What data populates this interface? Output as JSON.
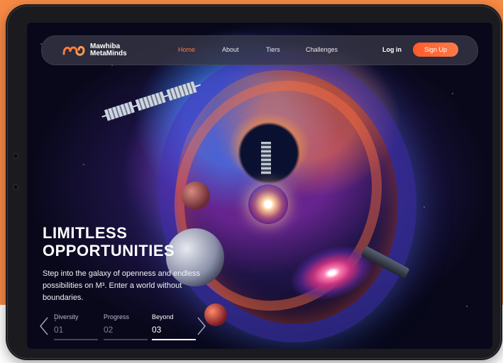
{
  "brand": {
    "name_line1": "Mawhiba",
    "name_line2": "MetaMinds",
    "accent": "#ff7a3c",
    "background": "#f68a45"
  },
  "nav": {
    "links": [
      "Home",
      "About",
      "Tiers",
      "Challenges"
    ],
    "active": "Home",
    "login": "Log in",
    "signup": "Sign Up"
  },
  "hero": {
    "headline_line1": "LIMITLESS",
    "headline_line2": "OPPORTUNITIES",
    "description": "Step into the galaxy of openness and endless possibilities on M³. Enter a world without boundaries."
  },
  "carousel": {
    "tabs": [
      {
        "label": "Diversity",
        "number": "01"
      },
      {
        "label": "Progress",
        "number": "02"
      },
      {
        "label": "Beyond",
        "number": "03"
      }
    ],
    "active_index": 2,
    "prev_icon": "chevron-left-icon",
    "next_icon": "chevron-right-icon"
  }
}
